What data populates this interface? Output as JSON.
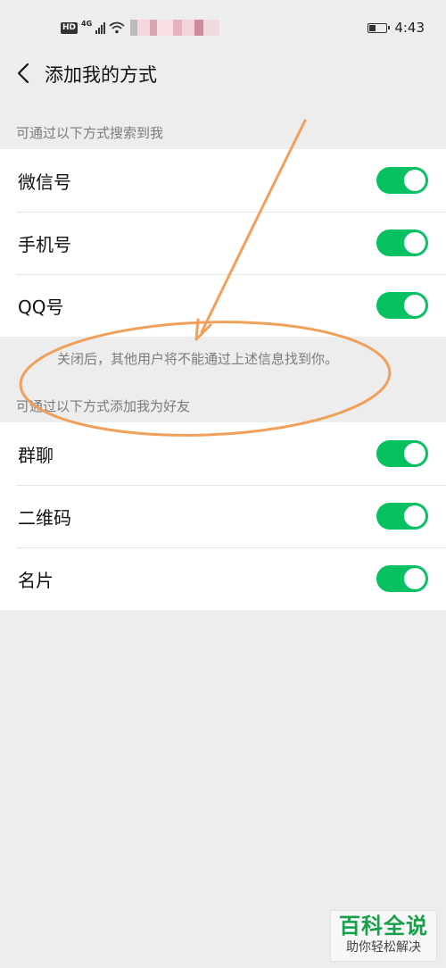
{
  "status_bar": {
    "hd": "HD",
    "network": "4G",
    "battery_level": 0.35,
    "time": "4:43"
  },
  "nav": {
    "back_icon": "chevron-left-icon",
    "title": "添加我的方式"
  },
  "search_section": {
    "header": "可通过以下方式搜索到我",
    "items": [
      {
        "label": "微信号",
        "enabled": true
      },
      {
        "label": "手机号",
        "enabled": true
      },
      {
        "label": "QQ号",
        "enabled": true
      }
    ],
    "hint": "关闭后，其他用户将不能通过上述信息找到你。"
  },
  "add_section": {
    "header": "可通过以下方式添加我为好友",
    "items": [
      {
        "label": "群聊",
        "enabled": true
      },
      {
        "label": "二维码",
        "enabled": true
      },
      {
        "label": "名片",
        "enabled": true
      }
    ]
  },
  "colors": {
    "toggle_on": "#07c160",
    "background": "#ededed",
    "annotation": "#f0a05a"
  },
  "watermark": {
    "title": "百科全说",
    "subtitle": "助你轻松解决"
  }
}
